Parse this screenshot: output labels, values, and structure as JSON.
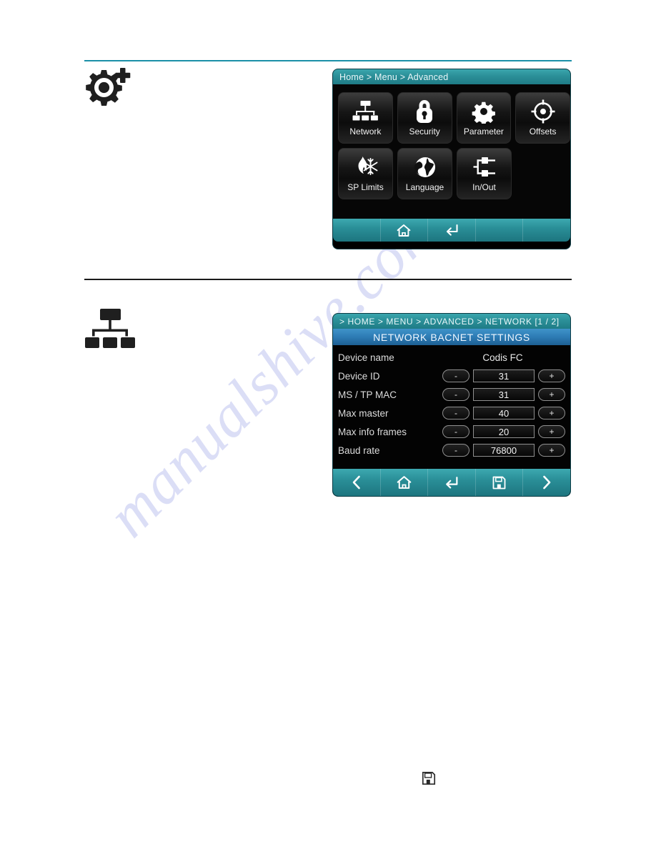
{
  "watermark": {
    "text": "manualshive.com"
  },
  "margin_icons": {
    "advanced_section": "gear-plus-icon",
    "network_section": "network-tree-icon",
    "save_note": "save-floppy-icon"
  },
  "advanced_screen": {
    "breadcrumb": "Home > Menu > Advanced",
    "tiles": [
      {
        "label": "Network",
        "icon": "network-tree-icon"
      },
      {
        "label": "Security",
        "icon": "padlock-icon"
      },
      {
        "label": "Parameter",
        "icon": "gear-icon"
      },
      {
        "label": "Offsets",
        "icon": "crosshair-target-icon"
      },
      {
        "label": "SP Limits",
        "icon": "flame-snowflake-icon"
      },
      {
        "label": "Language",
        "icon": "globe-icon"
      },
      {
        "label": "In/Out",
        "icon": "input-output-icon"
      }
    ],
    "nav": [
      {
        "icon": "empty-slot",
        "label": ""
      },
      {
        "icon": "home-icon",
        "label": "Home"
      },
      {
        "icon": "back-arrow-icon",
        "label": "Back"
      },
      {
        "icon": "empty-slot",
        "label": ""
      },
      {
        "icon": "empty-slot",
        "label": ""
      }
    ]
  },
  "network_screen": {
    "breadcrumb": "> HOME > MENU > ADVANCED > NETWORK [1 / 2]",
    "title": "NETWORK BACNET SETTINGS",
    "rows": [
      {
        "label": "Device name",
        "value": "Codis FC",
        "stepper": false
      },
      {
        "label": "Device ID",
        "value": "31",
        "stepper": true,
        "minus": "-",
        "plus": "+"
      },
      {
        "label": "MS / TP MAC",
        "value": "31",
        "stepper": true,
        "minus": "-",
        "plus": "+"
      },
      {
        "label": "Max master",
        "value": "40",
        "stepper": true,
        "minus": "-",
        "plus": "+"
      },
      {
        "label": "Max info frames",
        "value": "20",
        "stepper": true,
        "minus": "-",
        "plus": "+"
      },
      {
        "label": "Baud rate",
        "value": "76800",
        "stepper": true,
        "minus": "-",
        "plus": "+"
      }
    ],
    "nav": [
      {
        "icon": "chevron-left-icon",
        "label": "Previous"
      },
      {
        "icon": "home-icon",
        "label": "Home"
      },
      {
        "icon": "back-arrow-icon",
        "label": "Back"
      },
      {
        "icon": "save-floppy-icon",
        "label": "Save"
      },
      {
        "icon": "chevron-right-icon",
        "label": "Next"
      }
    ]
  },
  "colors": {
    "teal_bar": "#2a8f98",
    "blue_title": "#2d7bb4",
    "screen_bg": "#060606",
    "rule_teal": "#1b8fa8",
    "watermark": "#bfc4ef"
  }
}
